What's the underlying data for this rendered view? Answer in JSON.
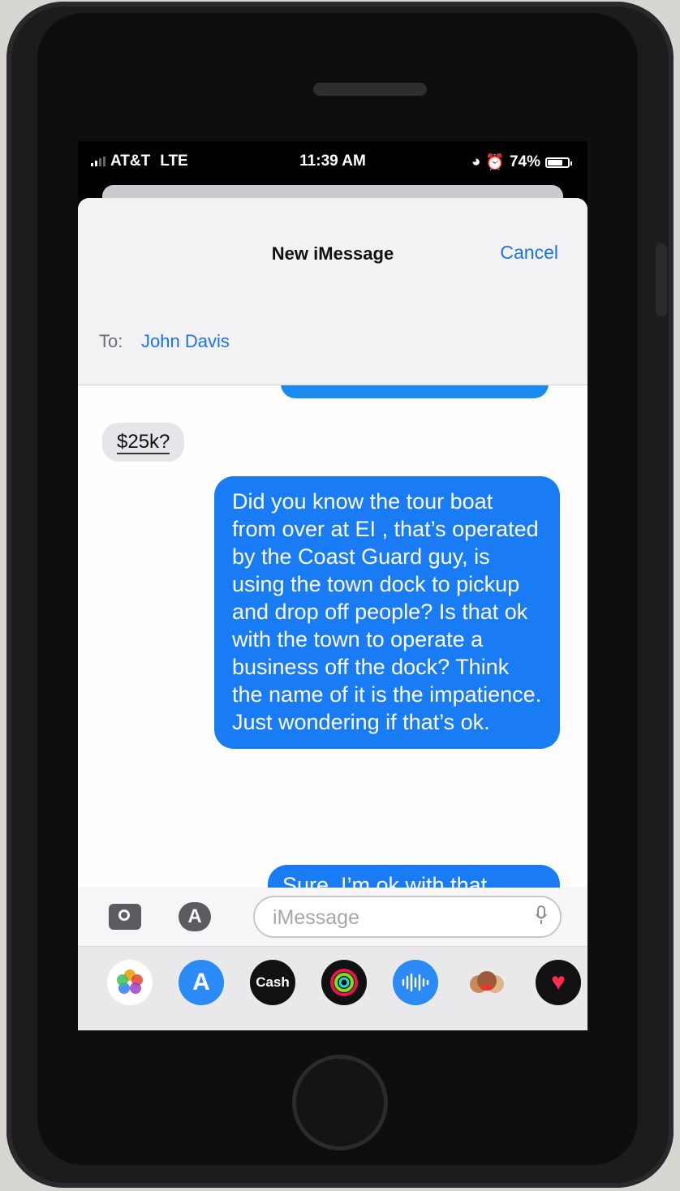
{
  "status_bar": {
    "carrier": "AT&T",
    "network": "LTE",
    "time": "11:39 AM",
    "battery": "74%",
    "battery_level": 0.74
  },
  "compose": {
    "title": "New iMessage",
    "cancel_label": "Cancel",
    "to_label": "To:",
    "recipient": "John Davis"
  },
  "thread": {
    "incoming_message": "$25k?",
    "outgoing_message_1": "Did you know the tour boat from over at EI , that’s operated by the Coast Guard guy, is using the town dock to pickup and drop off people? Is that ok with the town to operate a business off the dock?  Think the name of it is the impatience. Just wondering if that’s ok.",
    "outgoing_message_2": "Sure.  I’m ok with that"
  },
  "input": {
    "placeholder": "iMessage"
  },
  "app_drawer": {
    "apps": [
      {
        "name": "photos-icon",
        "label": ""
      },
      {
        "name": "app-store-icon",
        "label": ""
      },
      {
        "name": "cash-icon",
        "label": "Cash"
      },
      {
        "name": "activity-icon",
        "label": ""
      },
      {
        "name": "audio-message-icon",
        "label": ""
      },
      {
        "name": "memoji-icon",
        "label": ""
      },
      {
        "name": "digital-touch-icon",
        "label": ""
      }
    ]
  }
}
